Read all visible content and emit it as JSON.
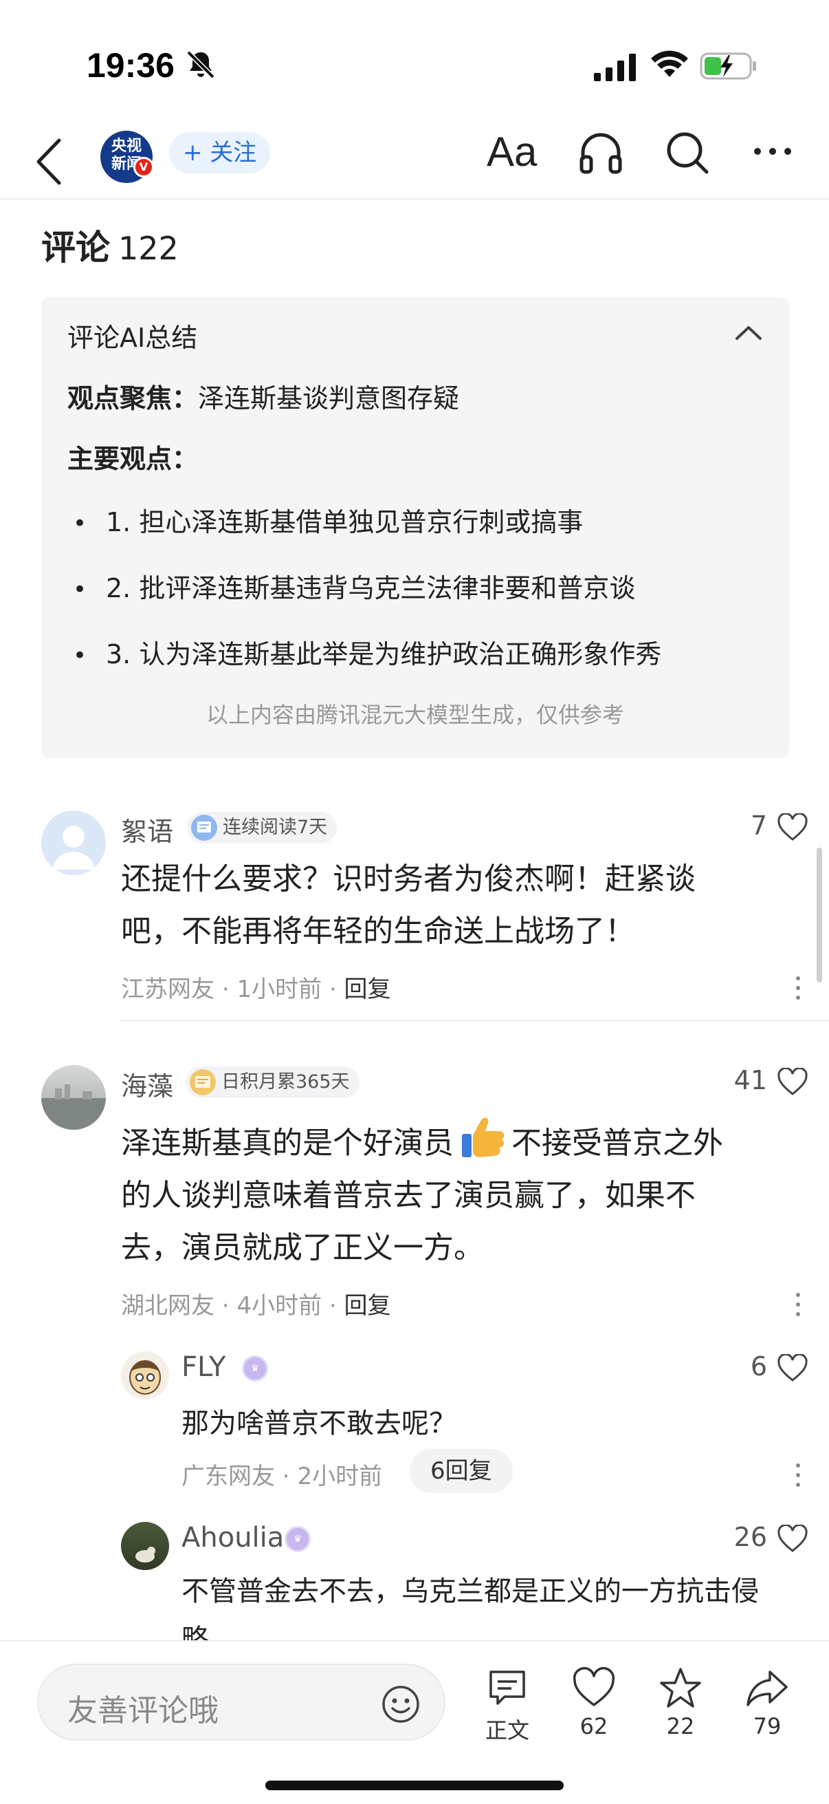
{
  "status_bar": {
    "time": "19:36"
  },
  "nav": {
    "channel_logo_line1": "央视",
    "channel_logo_line2": "新闻",
    "verified_mark": "V",
    "follow_label": "+ 关注",
    "font_size_label": "Aa"
  },
  "comments_header": {
    "title": "评论",
    "count": "122"
  },
  "ai_summary": {
    "title": "评论AI总结",
    "focus_label": "观点聚焦：",
    "focus_text": "泽连斯基谈判意图存疑",
    "main_points_label": "主要观点：",
    "points": [
      "1. 担心泽连斯基借单独见普京行刺或搞事",
      "2. 批评泽连斯基违背乌克兰法律非要和普京谈",
      "3. 认为泽连斯基此举是为维护政治正确形象作秀"
    ],
    "disclaimer": "以上内容由腾讯混元大模型生成，仅供参考"
  },
  "comments": [
    {
      "username": "絮语",
      "badge": "连续阅读7天",
      "likes": "7",
      "text_line1": "还提什么要求？识时务者为俊杰啊！赶紧谈",
      "text_line2": "吧，不能再将年轻的生命送上战场了！",
      "location": "江苏网友",
      "time": "1小时前",
      "reply_label": "回复"
    },
    {
      "username": "海藻",
      "badge": "日积月累365天",
      "likes": "41",
      "text_line1_a": "泽连斯基真的是个好演员",
      "text_line1_b": "不接受普京之外",
      "text_line2": "的人谈判意味着普京去了演员赢了，如果不",
      "text_line3": "去，演员就成了正义一方。",
      "location": "湖北网友",
      "time": "4小时前",
      "reply_label": "回复"
    }
  ],
  "replies": [
    {
      "username": "FLY",
      "likes": "6",
      "text": "那为啥普京不敢去呢？",
      "location": "广东网友",
      "time": "2小时前",
      "reply_count": "6回复"
    },
    {
      "username": "Ahoulia",
      "likes": "26",
      "text_line1": "不管普金去不去，乌克兰都是正义的一方抗击侵",
      "text_line2": "略"
    }
  ],
  "bottom_bar": {
    "input_placeholder": "友善评论哦",
    "article_label": "正文",
    "like_count": "62",
    "favorite_count": "22",
    "share_count": "79"
  },
  "colors": {
    "accent": "#2a6fd6",
    "verified": "#e0261c",
    "muted": "#999999"
  }
}
